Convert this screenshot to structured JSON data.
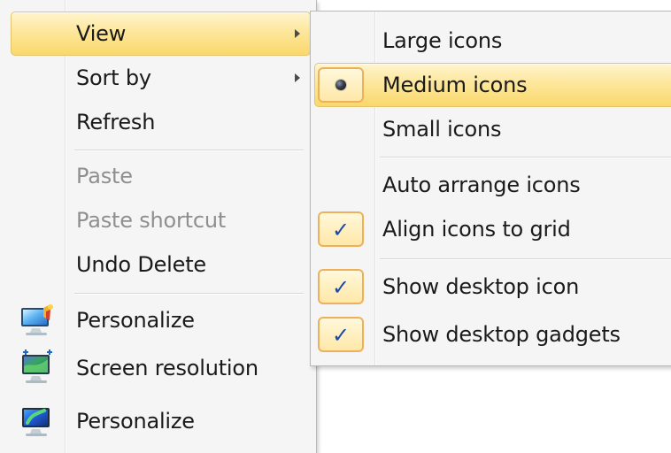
{
  "desktop_context_menu": {
    "items": [
      {
        "label": "View",
        "arrow_icon": "chevron-right-icon"
      },
      {
        "label": "Sort by",
        "arrow_icon": "chevron-right-icon"
      },
      {
        "label": "Refresh"
      },
      {
        "label": "Paste"
      },
      {
        "label": "Paste shortcut"
      },
      {
        "label": "Undo Delete"
      },
      {
        "label": "Personalize",
        "icon": "personalize-icon"
      },
      {
        "label": "Screen resolution",
        "icon": "screen-resolution-icon"
      },
      {
        "label": "Personalize",
        "icon": "personalize-icon"
      }
    ]
  },
  "view_submenu": {
    "items": [
      {
        "label": "Large icons"
      },
      {
        "label": "Medium icons",
        "state": "selected",
        "indicator_icon": "radio-selected-icon"
      },
      {
        "label": "Small icons"
      },
      {
        "label": "Auto arrange icons"
      },
      {
        "label": "Align icons to grid",
        "state": "checked",
        "indicator_icon": "checkmark-icon"
      },
      {
        "label": "Show desktop icon",
        "state": "checked",
        "indicator_icon": "checkmark-icon"
      },
      {
        "label": "Show desktop gadgets",
        "state": "checked",
        "indicator_icon": "checkmark-icon"
      }
    ]
  },
  "colors": {
    "highlight_top": "#fff5cd",
    "highlight_bottom": "#f9d86b",
    "highlight_border": "#e3c46d",
    "check_border": "#eeb15b",
    "check_color": "#1d4aa8",
    "menu_background": "#f5f5f5",
    "disabled_text": "#8f8f8f"
  }
}
